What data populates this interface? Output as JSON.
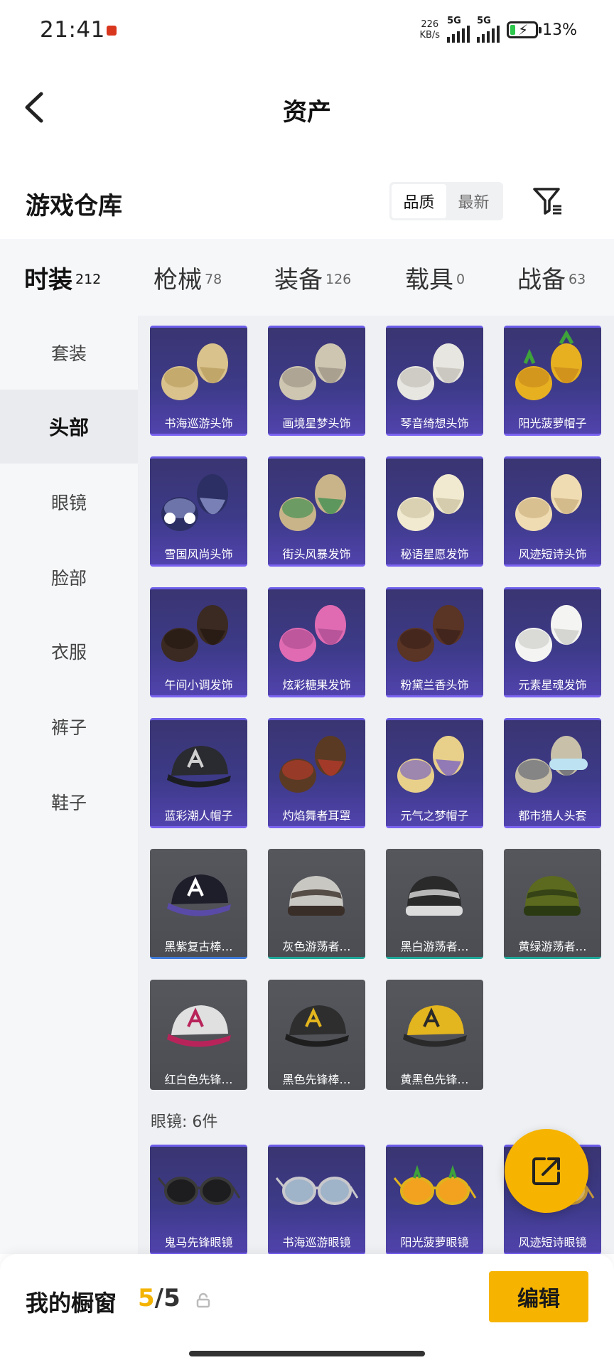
{
  "status_bar": {
    "time": "21:41",
    "net_speed_value": "226",
    "net_speed_unit": "KB/s",
    "signal1_label": "5G",
    "signal2_label": "5G",
    "battery_percent": "13%"
  },
  "header": {
    "title": "资产"
  },
  "warehouse": {
    "title": "游戏仓库",
    "sort_options": [
      "品质",
      "最新"
    ],
    "sort_active": "品质"
  },
  "category_tabs": [
    {
      "name": "时装",
      "count": "212",
      "active": true
    },
    {
      "name": "枪械",
      "count": "78",
      "active": false
    },
    {
      "name": "装备",
      "count": "126",
      "active": false
    },
    {
      "name": "载具",
      "count": "0",
      "active": false
    },
    {
      "name": "战备",
      "count": "63",
      "active": false
    }
  ],
  "side_nav": [
    {
      "label": "套装",
      "active": false
    },
    {
      "label": "头部",
      "active": true
    },
    {
      "label": "眼镜",
      "active": false
    },
    {
      "label": "脸部",
      "active": false
    },
    {
      "label": "衣服",
      "active": false
    },
    {
      "label": "裤子",
      "active": false
    },
    {
      "label": "鞋子",
      "active": false
    }
  ],
  "head_items": [
    {
      "name": "书海巡游头饰",
      "rarity": "purple",
      "art": "hair-blonde"
    },
    {
      "name": "画境星梦头饰",
      "rarity": "purple",
      "art": "hair-ash"
    },
    {
      "name": "琴音绮想头饰",
      "rarity": "purple",
      "art": "hair-white"
    },
    {
      "name": "阳光菠萝帽子",
      "rarity": "purple",
      "art": "pineapple-hat"
    },
    {
      "name": "雪国风尚头饰",
      "rarity": "purple",
      "art": "hair-navy"
    },
    {
      "name": "街头风暴发饰",
      "rarity": "purple",
      "art": "hair-green"
    },
    {
      "name": "秘语星愿发饰",
      "rarity": "purple",
      "art": "hair-platinum"
    },
    {
      "name": "风迹短诗头饰",
      "rarity": "purple",
      "art": "hair-cream"
    },
    {
      "name": "午间小调发饰",
      "rarity": "purple",
      "art": "hair-dark"
    },
    {
      "name": "炫彩糖果发饰",
      "rarity": "purple",
      "art": "hair-pink"
    },
    {
      "name": "粉黛兰香头饰",
      "rarity": "purple",
      "art": "hair-brown"
    },
    {
      "name": "元素星魂发饰",
      "rarity": "purple",
      "art": "hair-silver"
    },
    {
      "name": "蓝彩潮人帽子",
      "rarity": "purple",
      "art": "cap-black"
    },
    {
      "name": "灼焰舞者耳罩",
      "rarity": "purple",
      "art": "earmuff"
    },
    {
      "name": "元气之梦帽子",
      "rarity": "purple",
      "art": "hair-gold"
    },
    {
      "name": "都市猎人头套",
      "rarity": "purple",
      "art": "hood-goggle"
    },
    {
      "name": "黑紫复古棒…",
      "rarity": "grey-blue",
      "art": "cap-purple"
    },
    {
      "name": "灰色游荡者…",
      "rarity": "grey-teal",
      "art": "beanie-grey"
    },
    {
      "name": "黑白游荡者…",
      "rarity": "grey-teal",
      "art": "beanie-zebra"
    },
    {
      "name": "黄绿游荡者…",
      "rarity": "grey-teal",
      "art": "beanie-stripe"
    },
    {
      "name": "红白色先锋…",
      "rarity": "grey",
      "art": "cap-redwhite"
    },
    {
      "name": "黑色先锋棒…",
      "rarity": "grey",
      "art": "cap-blackgold"
    },
    {
      "name": "黄黑色先锋…",
      "rarity": "grey",
      "art": "cap-yellowblack"
    }
  ],
  "glasses_section": {
    "label": "眼镜: 6件"
  },
  "glasses_items": [
    {
      "name": "鬼马先锋眼镜",
      "rarity": "purple",
      "art": "glasses-dark"
    },
    {
      "name": "书海巡游眼镜",
      "rarity": "purple",
      "art": "glasses-round"
    },
    {
      "name": "阳光菠萝眼镜",
      "rarity": "purple",
      "art": "glasses-pineapple"
    },
    {
      "name": "风迹短诗眼镜",
      "rarity": "purple",
      "art": "glasses-gold"
    }
  ],
  "fab": {
    "icon": "share-external-icon"
  },
  "showcase": {
    "title": "我的橱窗",
    "current": "5",
    "separator": "/",
    "max": "5",
    "edit_label": "编辑"
  },
  "colors": {
    "accent": "#f6b400",
    "purple_card": "#3d3a88",
    "grey_card": "#505258"
  }
}
